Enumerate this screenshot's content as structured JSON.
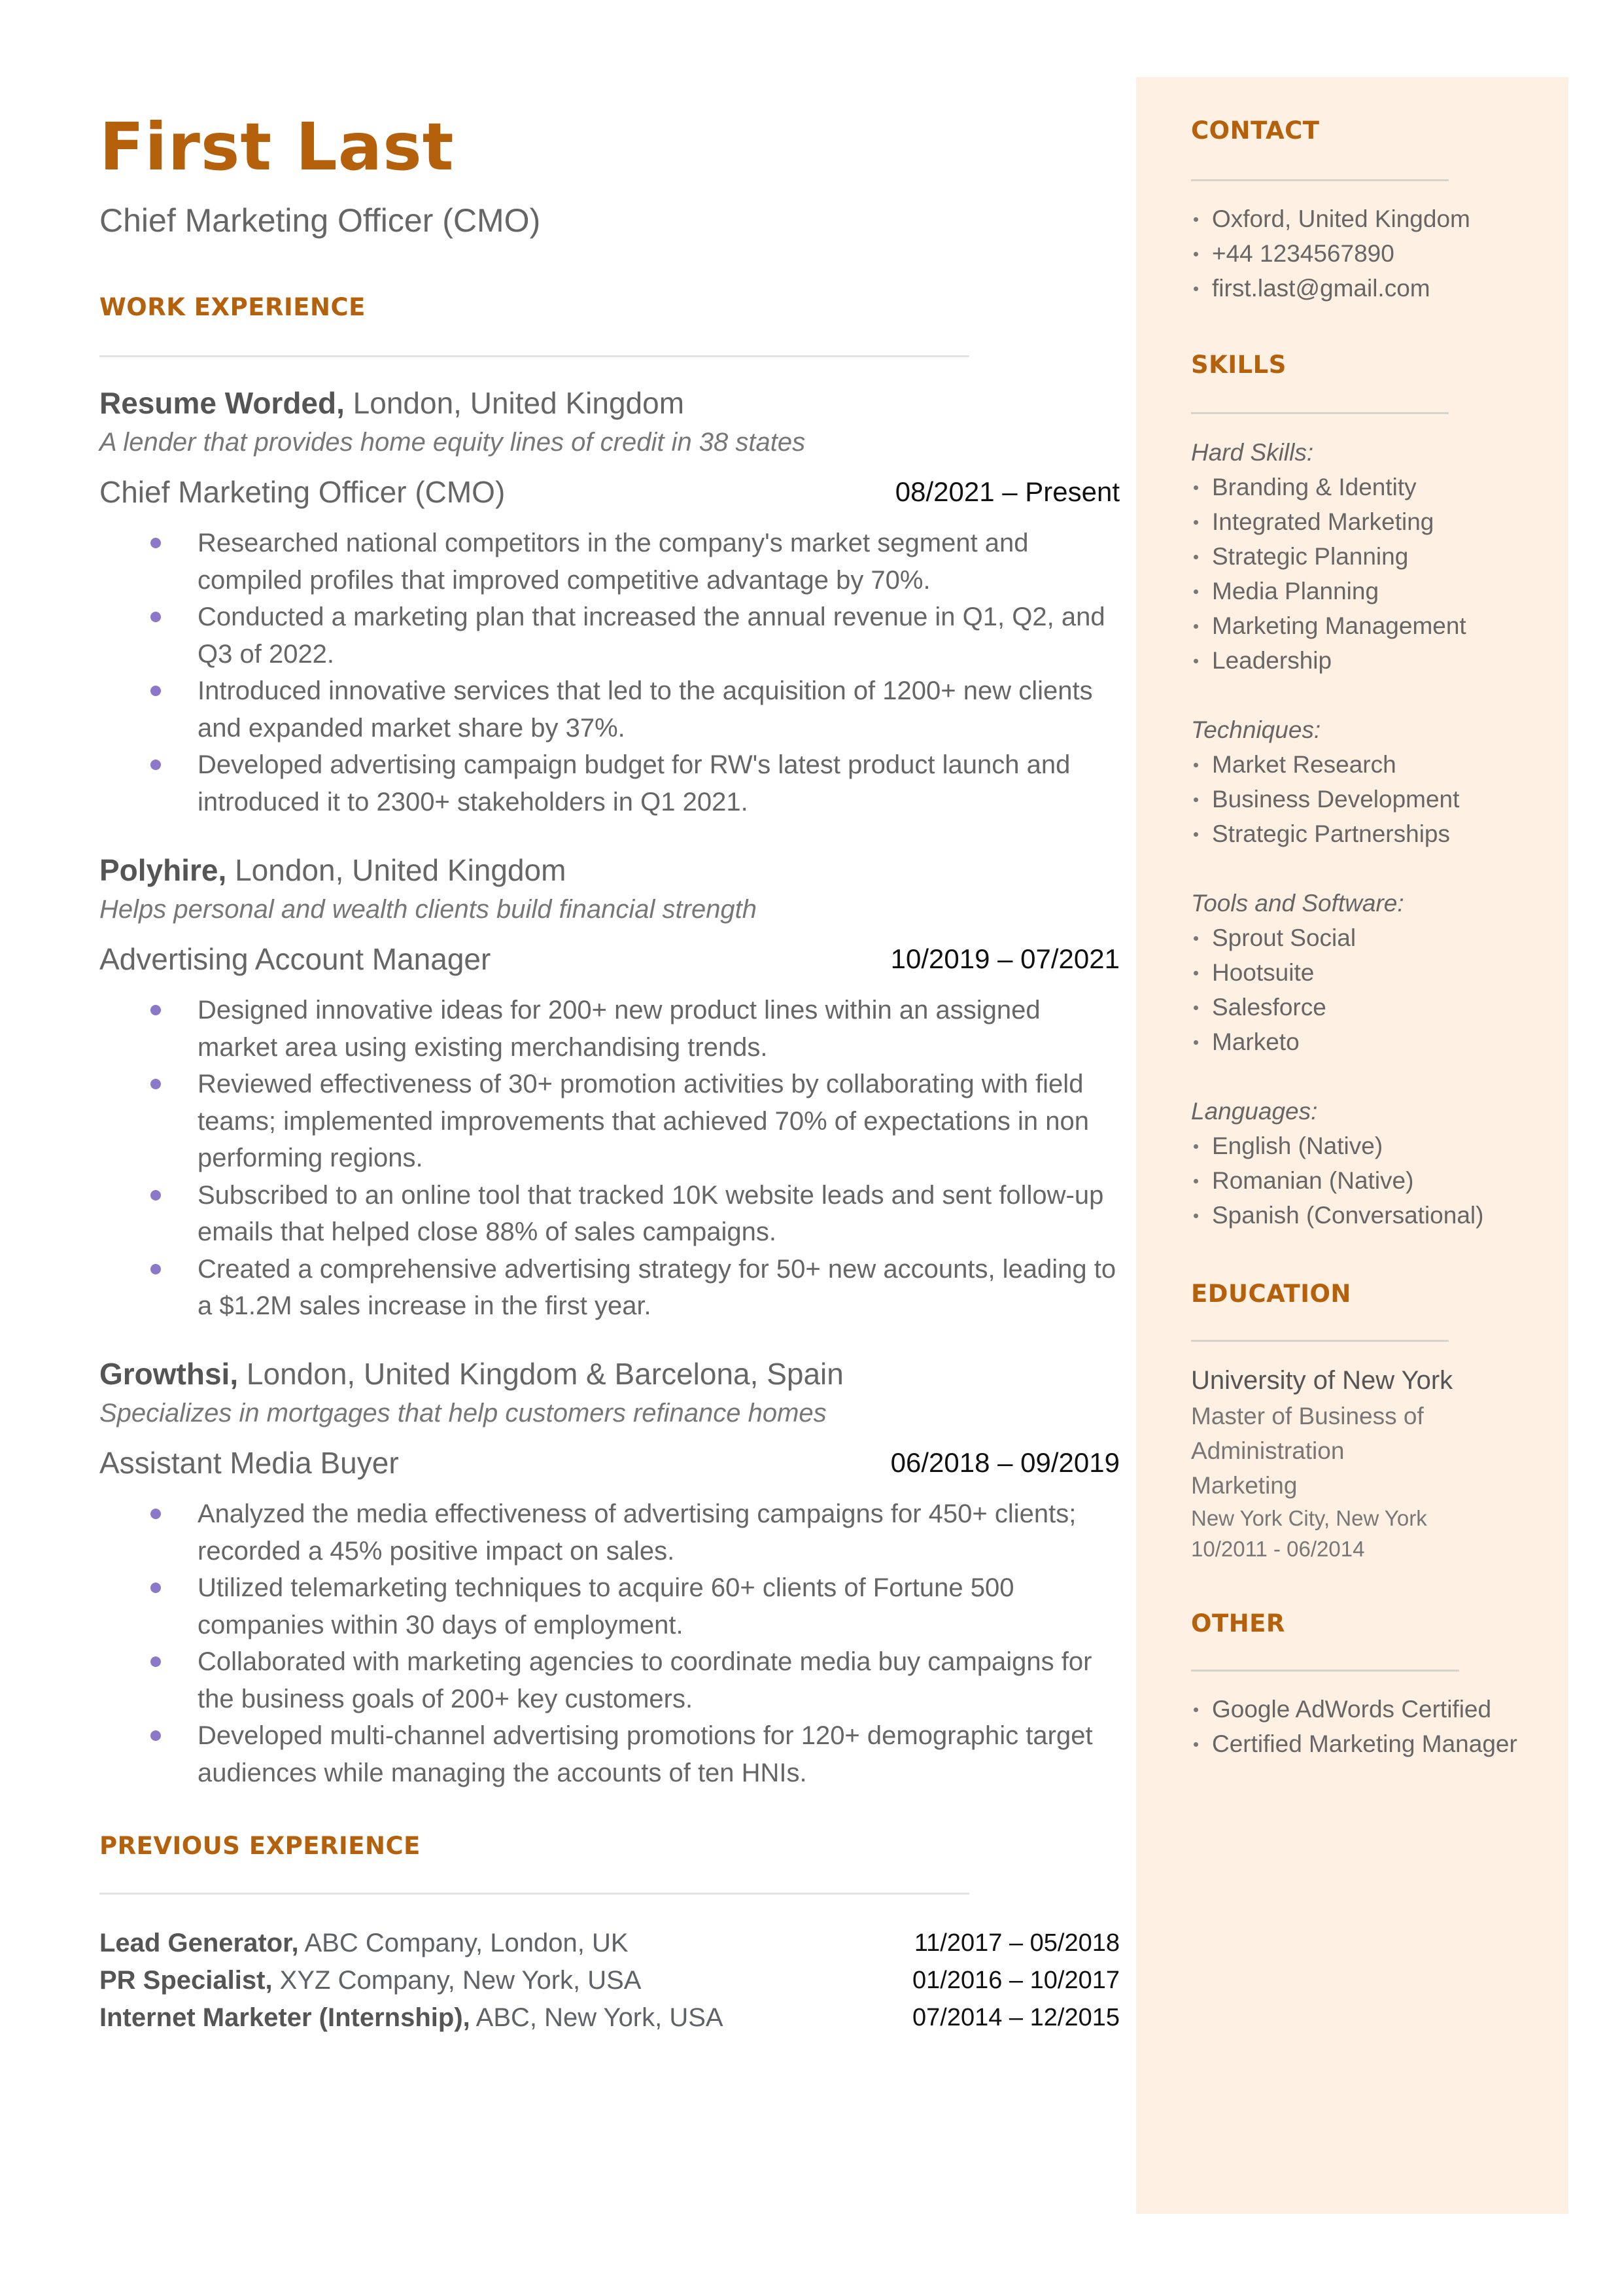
{
  "header": {
    "name": "First Last",
    "title": "Chief Marketing Officer (CMO)"
  },
  "colors": {
    "accent": "#B5600B",
    "sidebar_bg": "#FEF0E2",
    "bullet": "#8B78C8",
    "text": "#666666"
  },
  "work_experience": {
    "section_title": "WORK EXPERIENCE",
    "jobs": [
      {
        "company": "Resume Worded,",
        "location": " London, United Kingdom",
        "description": "A lender that provides home equity lines of credit in 38 states",
        "role": "Chief Marketing Officer (CMO)",
        "dates": "08/2021 – Present",
        "bullets": [
          "Researched national competitors in the company's market segment and compiled profiles that improved competitive advantage by 70%.",
          "Conducted a marketing plan that increased the annual revenue in Q1, Q2, and Q3 of 2022.",
          "Introduced innovative services that led to the acquisition of 1200+ new clients and expanded market share by 37%.",
          "Developed advertising campaign budget for RW's latest product launch and introduced it to 2300+ stakeholders in Q1 2021."
        ]
      },
      {
        "company": "Polyhire,",
        "location": " London, United Kingdom",
        "description": "Helps personal and wealth clients build financial strength",
        "role": "Advertising Account Manager",
        "dates": "10/2019 – 07/2021",
        "bullets": [
          "Designed innovative ideas for 200+ new product lines within an assigned market area using existing merchandising trends.",
          "Reviewed effectiveness of 30+ promotion activities by collaborating with field teams; implemented improvements that achieved 70% of expectations in non performing regions.",
          "Subscribed to an online tool that tracked 10K website leads and sent follow-up emails that helped close 88% of sales campaigns.",
          "Created a comprehensive advertising strategy for 50+ new accounts, leading to a $1.2M sales increase in the first year."
        ]
      },
      {
        "company": "Growthsi,",
        "location": " London, United Kingdom & Barcelona, Spain",
        "description": "Specializes in mortgages that help customers refinance homes",
        "role": "Assistant Media Buyer",
        "dates": "06/2018 – 09/2019",
        "bullets": [
          "Analyzed the media effectiveness of advertising campaigns for 450+ clients; recorded a 45% positive impact on sales.",
          "Utilized telemarketing techniques to acquire 60+ clients of Fortune 500 companies within 30 days of employment.",
          "Collaborated with marketing agencies to coordinate media buy campaigns for the business goals of 200+ key customers.",
          "Developed multi-channel advertising promotions for 120+ demographic target audiences while managing the accounts of ten HNIs."
        ]
      }
    ]
  },
  "previous_experience": {
    "section_title": "PREVIOUS EXPERIENCE",
    "items": [
      {
        "role": "Lead Generator,",
        "detail": " ABC Company, London, UK",
        "dates": "11/2017 – 05/2018"
      },
      {
        "role": "PR Specialist,",
        "detail": " XYZ Company, New York, USA",
        "dates": "01/2016 – 10/2017"
      },
      {
        "role": "Internet Marketer (Internship),",
        "detail": " ABC, New York, USA",
        "dates": "07/2014 – 12/2015"
      }
    ]
  },
  "sidebar": {
    "contact": {
      "title": "CONTACT",
      "items": [
        "Oxford, United Kingdom",
        "+44 1234567890",
        "first.last@gmail.com"
      ]
    },
    "skills": {
      "title": "SKILLS",
      "groups": [
        {
          "label": "Hard Skills:",
          "items": [
            "Branding & Identity",
            "Integrated Marketing",
            "Strategic Planning",
            "Media Planning",
            "Marketing Management",
            "Leadership"
          ]
        },
        {
          "label": "Techniques:",
          "items": [
            "Market Research",
            "Business Development",
            "Strategic Partnerships"
          ]
        },
        {
          "label": "Tools and Software:",
          "items": [
            "Sprout Social",
            "Hootsuite",
            "Salesforce",
            "Marketo"
          ]
        },
        {
          "label": "Languages:",
          "items": [
            "English (Native)",
            "Romanian (Native)",
            "Spanish (Conversational)"
          ]
        }
      ]
    },
    "education": {
      "title": "EDUCATION",
      "school": "University of New York",
      "degree_line1": "Master of Business of",
      "degree_line2": "Administration",
      "major": "Marketing",
      "location": "New York City, New York",
      "dates": "10/2011 - 06/2014"
    },
    "other": {
      "title": "OTHER",
      "items": [
        "Google AdWords Certified",
        "Certified Marketing Manager"
      ]
    }
  }
}
